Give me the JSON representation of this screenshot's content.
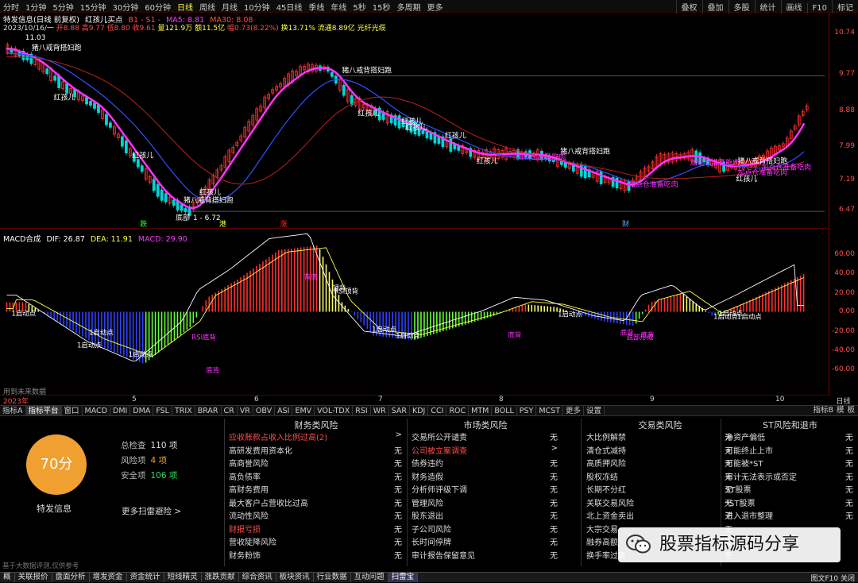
{
  "toolbar": {
    "periods": [
      "分时",
      "1分钟",
      "5分钟",
      "15分钟",
      "30分钟",
      "60分钟",
      "日线",
      "周线",
      "月线",
      "10分钟",
      "45日线",
      "季线",
      "年线",
      "5秒",
      "15秒",
      "多周期",
      "更多"
    ],
    "active_period": "日线",
    "right_tools": [
      "叠权",
      "叠加",
      "多股",
      "统计",
      "画线",
      "F10",
      "标记"
    ]
  },
  "kline": {
    "title": "特发信息(日线 前复权)",
    "indicator": "红孩儿买点",
    "params": "B1 - S1 -",
    "ma5": "MA5: 8.81",
    "ma30": "MA30: 8.08",
    "date": "2023/10/16/一",
    "open": "开8.88",
    "high": "高9.77",
    "low": "低8.80",
    "close": "收9.61",
    "volume": "量121.9万",
    "amount": "额11.5亿",
    "change": "幅0.73(8.22%)",
    "turnover": "换13.71%",
    "float": "流通8.89亿",
    "concept": "光纤光缆",
    "y_labels": [
      "10.74",
      "9.77",
      "8.88",
      "7.99",
      "7.19",
      "6.47"
    ],
    "price_marks": {
      "high": "11.03",
      "low": "1 - 6.72"
    },
    "bottom_marks": [
      "跌",
      "港",
      "涨",
      "财"
    ],
    "annotations": [
      "猪八戒背搭妇跑",
      "红孩儿",
      "红孩儿",
      "猪八戒背搭妇跑",
      "红孩儿",
      "红孩儿",
      "红孩儿",
      "加点仓准备吃肉",
      "猪八戒背搭妇跑",
      "加点仓准备吃肉",
      "加点仓准备吃肉",
      "红孩儿",
      "猪八戒背搭妇跑",
      "加点仓准备吃肉",
      "红孩儿",
      "猪八戒背搭妇跑",
      "红孩儿",
      "加点仓准备吃肉",
      "红孩儿",
      "底部"
    ]
  },
  "macd": {
    "name": "MACD合成",
    "dif": "DIF: 26.87",
    "dea": "DEA: 11.91",
    "macd": "MACD: 29.90",
    "y_labels": [
      "60.00",
      "40.00",
      "20.00",
      "0.00",
      "-20.00",
      "-40.00",
      "-60.00"
    ],
    "labels": [
      "1启动点",
      "1启动点",
      "1启动点",
      "RSI底背",
      "底背",
      "背底",
      "RSI顶背",
      "顶背",
      "1启动点",
      "1启动点",
      "底背",
      "1启动点",
      "底背",
      "1启动点",
      "底背",
      "底部形成",
      "1启动点",
      "1启动点",
      "1启动点"
    ],
    "future_text": "用到未来数据"
  },
  "dates": {
    "year": "2023年",
    "months": [
      "5",
      "6",
      "7",
      "8",
      "9",
      "10"
    ]
  },
  "day_label": "日线",
  "ind_tabs": [
    "指标A",
    "指标平台",
    "窗口",
    "MACD",
    "DMI",
    "DMA",
    "FSL",
    "TRIX",
    "BRAR",
    "CR",
    "VR",
    "OBV",
    "ASI",
    "EMV",
    "VOL-TDX",
    "RSI",
    "WR",
    "SAR",
    "KDJ",
    "CCI",
    "ROC",
    "MTM",
    "BOLL",
    "PSY",
    "MCST",
    "更多",
    "设置"
  ],
  "ind_right": [
    "指标B",
    "模",
    "板"
  ],
  "risk": {
    "score": "70分",
    "stock": "特发信息",
    "total_label": "总检查",
    "total": "110 项",
    "risk_label": "风险项",
    "risk_count": "4 项",
    "safe_label": "安全项",
    "safe_count": "106 项",
    "more": "更多扫雷避险 >",
    "columns": [
      {
        "head": "财务类风险",
        "rows": [
          {
            "k": "应收账款占收入比例过高(2)",
            "v": ">",
            "hot": true
          },
          {
            "k": "高研发费用资本化",
            "v": "无"
          },
          {
            "k": "高商誉风险",
            "v": "无"
          },
          {
            "k": "高负债率",
            "v": "无"
          },
          {
            "k": "高财务费用",
            "v": "无"
          },
          {
            "k": "最大客户占营收比过高",
            "v": "无"
          },
          {
            "k": "流动性风险",
            "v": "无"
          },
          {
            "k": "财报亏损",
            "v": "无",
            "hot": true
          },
          {
            "k": "营收陡降风险",
            "v": "无"
          },
          {
            "k": "财务粉饰",
            "v": "无"
          }
        ]
      },
      {
        "head": "市场类风险",
        "rows": [
          {
            "k": "交易所公开谴责",
            "v": "无"
          },
          {
            "k": "公司被立案调查",
            "v": ">",
            "hot": true
          },
          {
            "k": "债券违约",
            "v": "无"
          },
          {
            "k": "财务造假",
            "v": "无"
          },
          {
            "k": "分析师评级下调",
            "v": "无"
          },
          {
            "k": "管理风险",
            "v": "无"
          },
          {
            "k": "股东退出",
            "v": "无"
          },
          {
            "k": "子公司风险",
            "v": "无"
          },
          {
            "k": "长时间停牌",
            "v": "无"
          },
          {
            "k": "审计报告保留意见",
            "v": "无"
          }
        ]
      },
      {
        "head": "交易类风险",
        "rows": [
          {
            "k": "大比例解禁",
            "v": "无"
          },
          {
            "k": "清仓式减持",
            "v": "无"
          },
          {
            "k": "高质押风险",
            "v": "无"
          },
          {
            "k": "股权冻结",
            "v": "无"
          },
          {
            "k": "长期不分红",
            "v": "无"
          },
          {
            "k": "关联交易风险",
            "v": "无"
          },
          {
            "k": "北上资金卖出",
            "v": "无"
          },
          {
            "k": "大宗交易",
            "v": "无"
          },
          {
            "k": "融券高额",
            "v": "无"
          },
          {
            "k": "换手率过高",
            "v": "无"
          }
        ]
      },
      {
        "head": "ST风险和退市",
        "rows": [
          {
            "k": "净资产偏低",
            "v": "无"
          },
          {
            "k": "可能终止上市",
            "v": "无"
          },
          {
            "k": "可能被*ST",
            "v": "无"
          },
          {
            "k": "审计无法表示或否定",
            "v": "无"
          },
          {
            "k": "ST股票",
            "v": "无"
          },
          {
            "k": "*ST股票",
            "v": "无"
          },
          {
            "k": "进入退市整理",
            "v": "无"
          },
          {
            "k": "",
            "v": ""
          },
          {
            "k": "",
            "v": ""
          },
          {
            "k": "",
            "v": ""
          }
        ]
      }
    ],
    "disclaimer": "基于大数据评测,仅供参考"
  },
  "watermark": "股票指标源码分享",
  "bottom_tabs": [
    "概",
    "关联报价",
    "盘面分析",
    "增发资金",
    "资金统计",
    "短线精灵",
    "涨跌贡献",
    "综合资讯",
    "板块资讯",
    "行业数据",
    "互动问题",
    "扫雷宝"
  ],
  "bottom_right": "图文F10 关闭",
  "colors": {
    "up": "#ff3030",
    "down": "#00d4d4",
    "ma_pink": "#ff33ff",
    "ma_blue": "#3050ff",
    "ma_red": "#c02020",
    "score": "#f0a030"
  }
}
